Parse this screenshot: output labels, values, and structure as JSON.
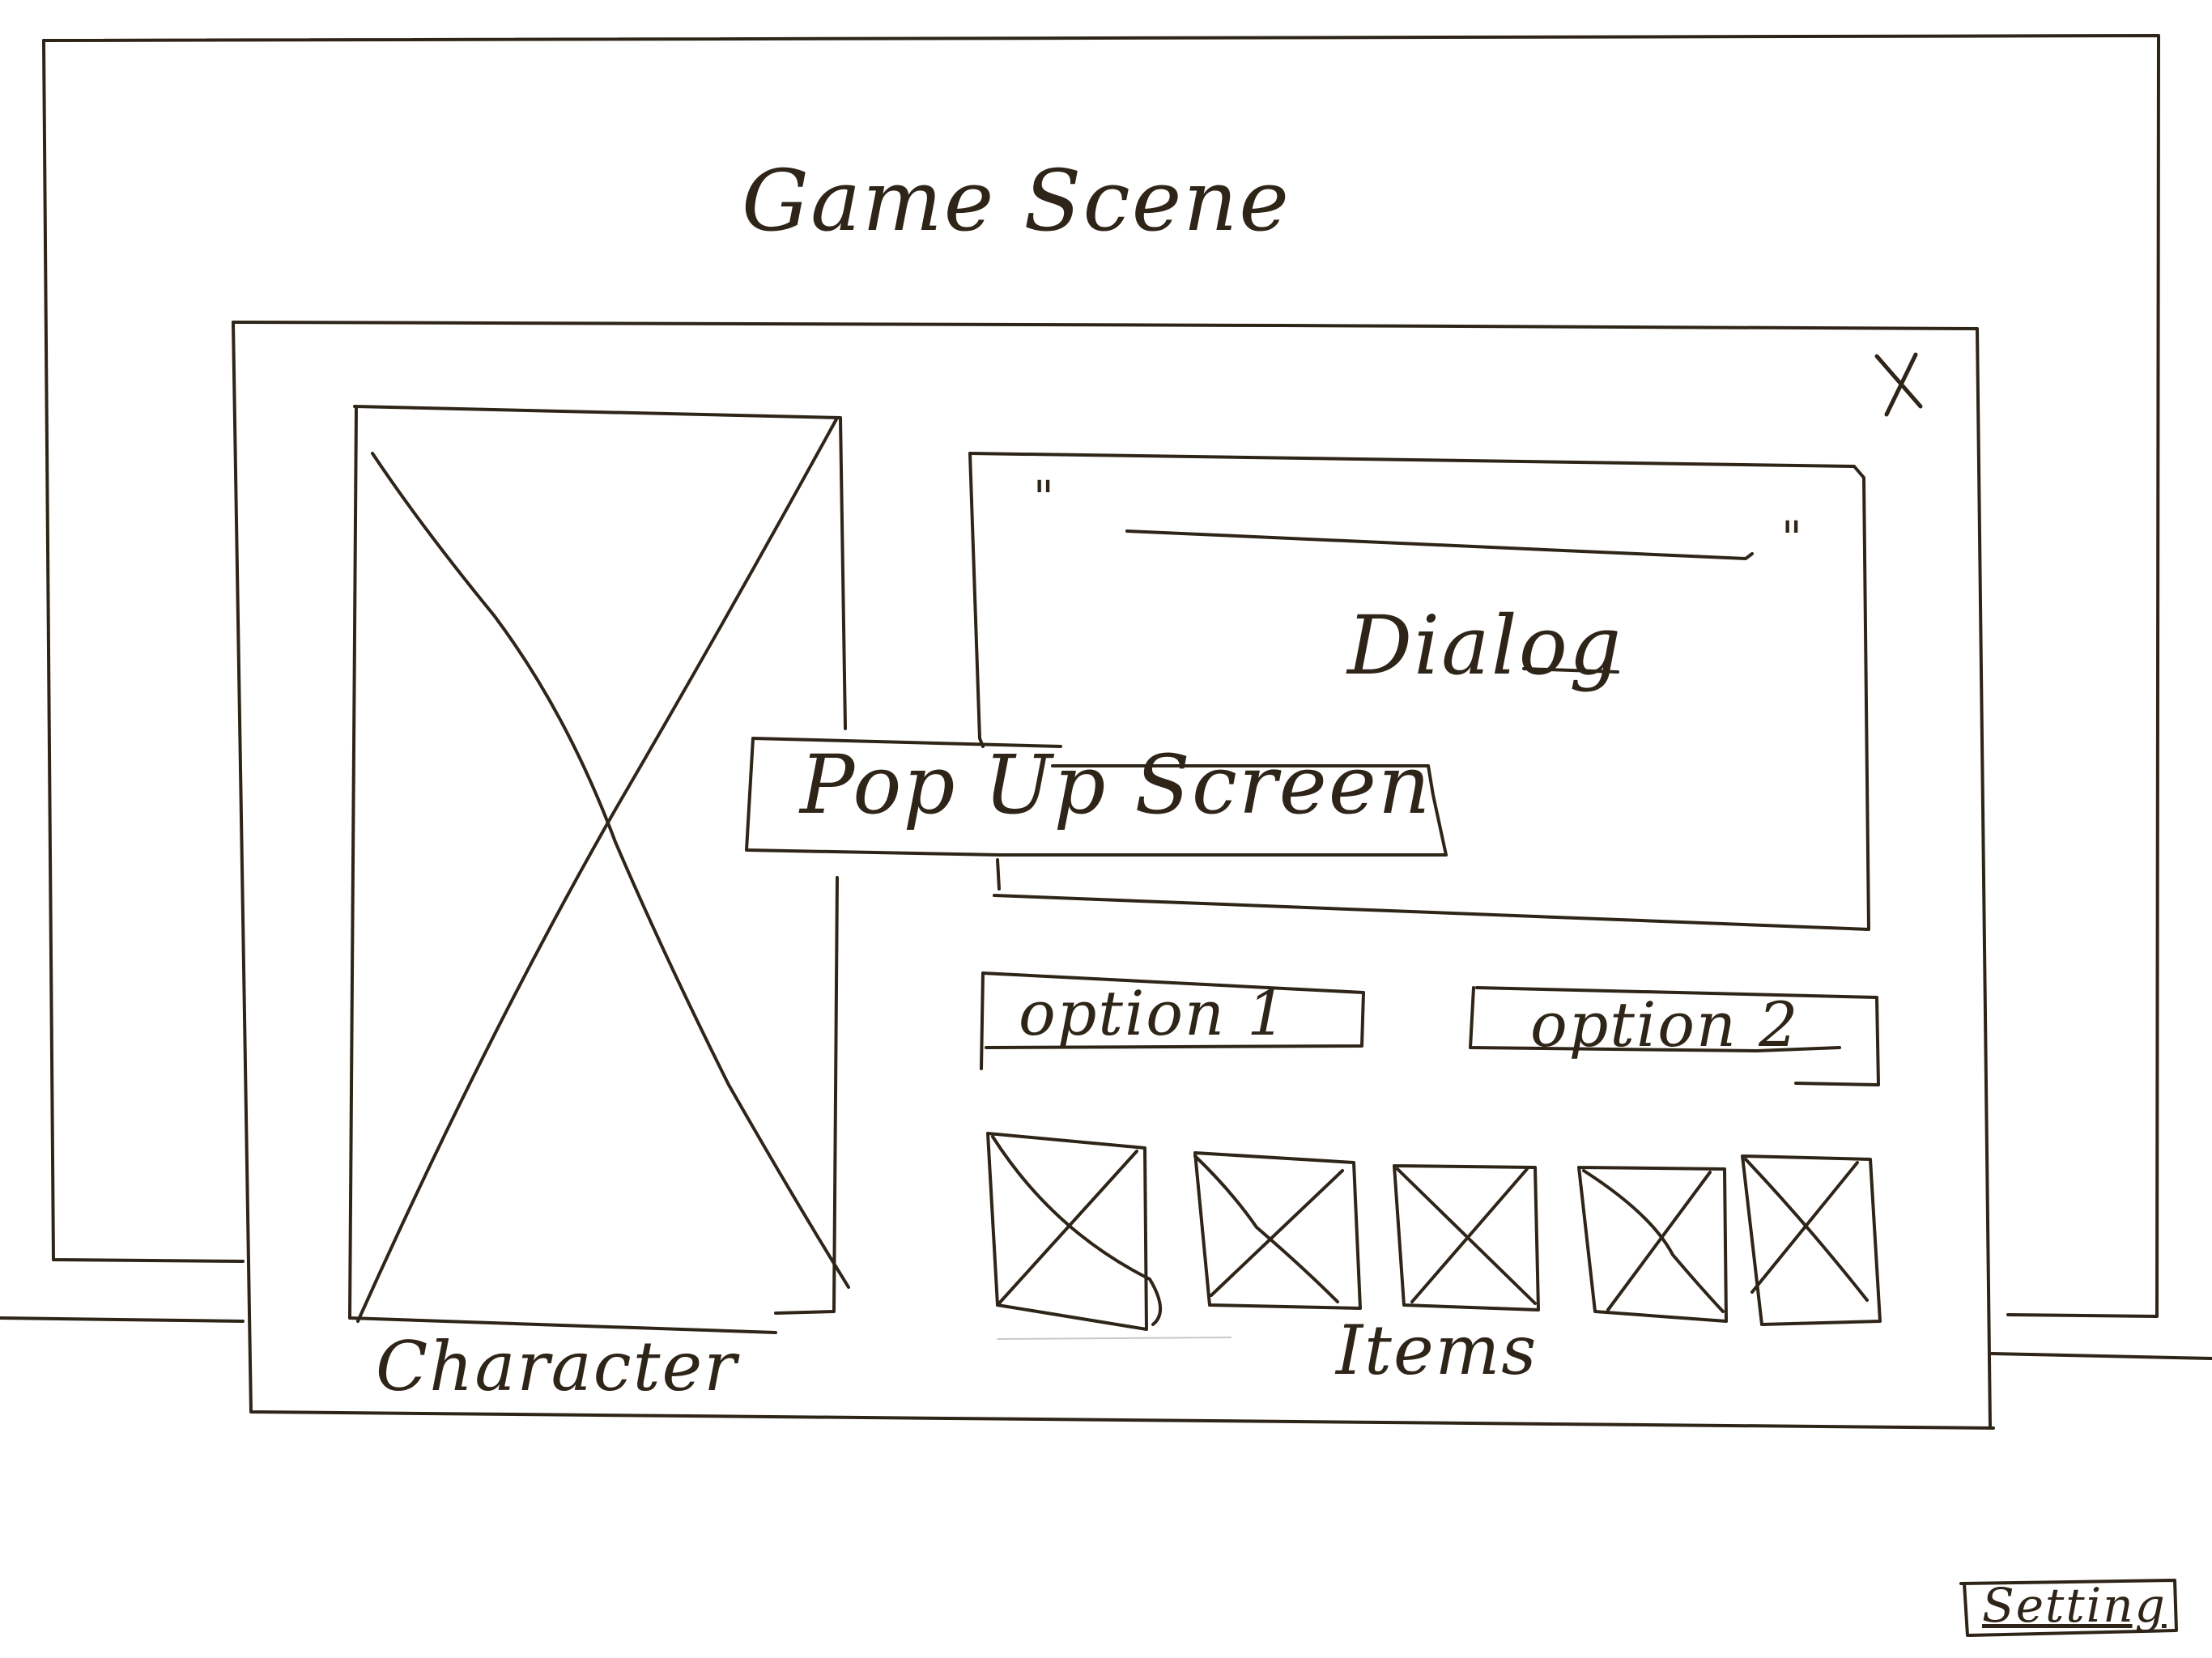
{
  "game_scene": {
    "title": "Game Scene"
  },
  "popup": {
    "title": "Pop Up Screen",
    "close_icon": "close-icon",
    "character_label": "Character",
    "dialog": {
      "label": "Dialog",
      "quote_open": "\"",
      "quote_close": "\""
    },
    "options": [
      {
        "label": "option 1"
      },
      {
        "label": "option 2"
      }
    ],
    "items_label": "Items",
    "items": [
      {
        "icon": "image-placeholder-icon"
      },
      {
        "icon": "image-placeholder-icon"
      },
      {
        "icon": "image-placeholder-icon"
      },
      {
        "icon": "image-placeholder-icon"
      },
      {
        "icon": "image-placeholder-icon"
      }
    ]
  },
  "setting_button": {
    "label": "Setting"
  },
  "colors": {
    "ink": "#2e2418",
    "paper": "#ffffff"
  }
}
